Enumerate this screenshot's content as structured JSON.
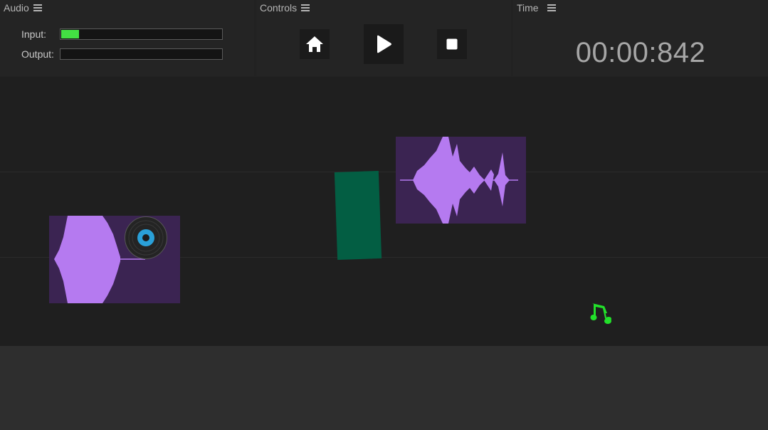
{
  "panels": {
    "audio": {
      "title": "Audio",
      "input_label": "Input:",
      "output_label": "Output:",
      "input_level": 0.11,
      "output_level": 0.0
    },
    "controls": {
      "title": "Controls"
    },
    "time": {
      "title": "Time",
      "display": "00:00:842"
    }
  },
  "icons": {
    "menu": "menu-icon",
    "home": "home-icon",
    "play": "play-icon",
    "stop": "stop-icon",
    "vinyl": "vinyl-record-icon",
    "music_note": "music-note-icon"
  },
  "colors": {
    "meter_fill": "#43e043",
    "clip_background": "#3b2452",
    "waveform": "#b57af0",
    "green_block": "#035e43",
    "music_note": "#22e02a",
    "vinyl_label": "#2aa0d8"
  }
}
